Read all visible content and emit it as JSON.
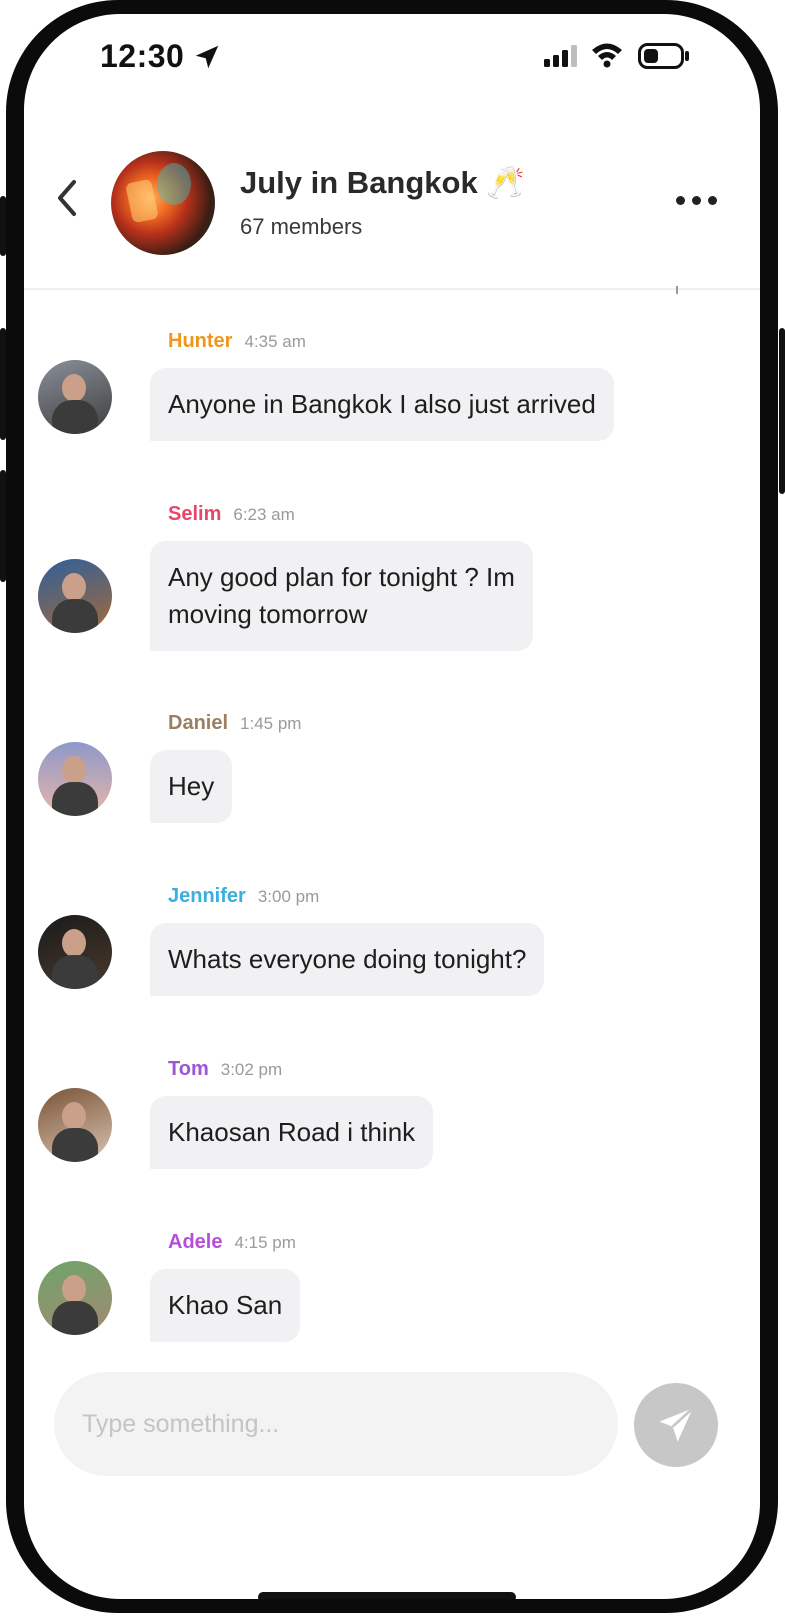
{
  "status_bar": {
    "time": "12:30",
    "icons": [
      "location-arrow-icon",
      "cellular-signal-icon",
      "wifi-icon",
      "battery-icon"
    ]
  },
  "header": {
    "title": "July in Bangkok 🥂",
    "subtitle": "67 members",
    "icons": [
      "back-chevron-icon",
      "more-options-icon"
    ]
  },
  "messages": [
    {
      "name": "Hunter",
      "time": "4:35 am",
      "color": "#f0961e",
      "lines": [
        "Anyone in Bangkok I also just arrived"
      ]
    },
    {
      "name": "Selim",
      "time": "6:23 am",
      "color": "#e8456a",
      "lines": [
        "Any good plan for tonight ? Im",
        "moving tomorrow"
      ]
    },
    {
      "name": "Daniel",
      "time": "1:45 pm",
      "color": "#9c7e63",
      "lines": [
        "Hey"
      ]
    },
    {
      "name": "Jennifer",
      "time": "3:00 pm",
      "color": "#3aaee0",
      "lines": [
        "Whats everyone doing tonight?"
      ]
    },
    {
      "name": "Tom",
      "time": "3:02 pm",
      "color": "#9b55d6",
      "lines": [
        "Khaosan Road i think"
      ]
    },
    {
      "name": "Adele",
      "time": "4:15 pm",
      "color": "#b54fd9",
      "lines": [
        "Khao San"
      ]
    }
  ],
  "composer": {
    "placeholder": "Type something...",
    "send_icon": "send-paper-plane-icon"
  }
}
